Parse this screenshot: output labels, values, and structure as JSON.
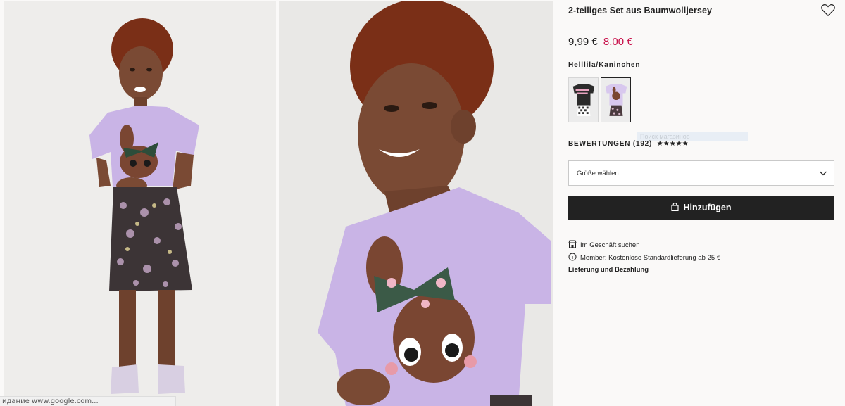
{
  "product": {
    "title": "2-teiliges Set aus Baumwolljersey",
    "price_old": "9,99 €",
    "price_new": "8,00 €",
    "color_name": "Helllila/Kaninchen"
  },
  "icons": {
    "favorite": "heart-outline-icon",
    "chevron": "chevron-down-icon",
    "bag": "shopping-bag-icon",
    "store": "store-icon",
    "info": "info-circle-icon"
  },
  "colors": {
    "sale_price": "#c8104a",
    "button_bg": "#222222",
    "shirt_lilac": "#c9b4e6"
  },
  "reviews": {
    "label": "BEWERTUNGEN (192)",
    "stars": "★★★★★",
    "rating": 5
  },
  "ghost_text": "Поиск магазинов",
  "size_select": {
    "placeholder": "Größe wählen"
  },
  "add_button": {
    "label": "Hinzufügen"
  },
  "info": {
    "store_search": "Im Geschäft suchen",
    "member_delivery": "Member: Kostenlose Standardlieferung ab 25 €",
    "delivery_payment": "Lieferung und Bezahlung"
  },
  "status_bar": {
    "text": "идание www.google.com..."
  }
}
